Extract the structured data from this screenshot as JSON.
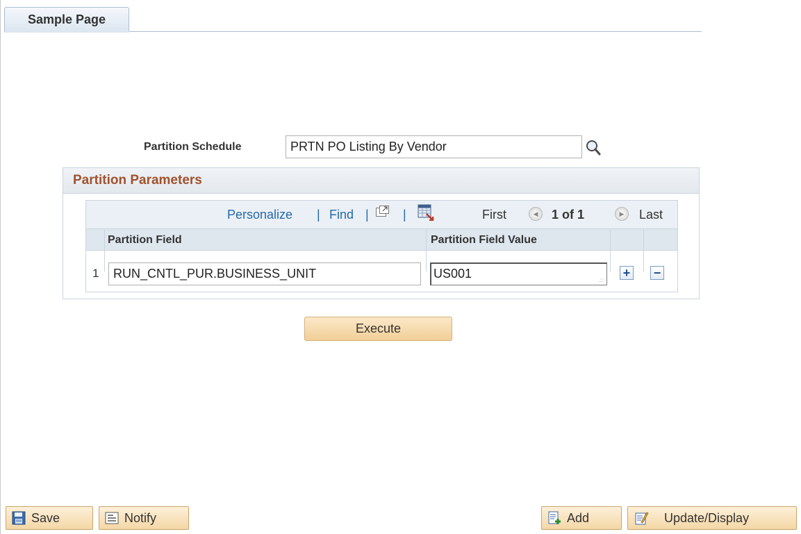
{
  "tab": {
    "label": "Sample Page"
  },
  "schedule": {
    "label": "Partition Schedule",
    "value": "PRTN PO Listing By Vendor"
  },
  "group": {
    "title": "Partition Parameters",
    "nav": {
      "personalize": "Personalize",
      "sep": "|",
      "find": "Find",
      "first": "First",
      "position": "1 of 1",
      "last": "Last"
    },
    "columns": [
      "Partition Field",
      "Partition Field Value"
    ],
    "rows": [
      {
        "num": "1",
        "field": "RUN_CNTL_PUR.BUSINESS_UNIT",
        "value": "US001"
      }
    ]
  },
  "execute": {
    "label": "Execute"
  },
  "toolbar": {
    "save": "Save",
    "notify": "Notify",
    "add": "Add",
    "update": "Update/Display"
  },
  "colors": {
    "accent": "#a0522d",
    "link": "#2569ad",
    "button": "#f1cf97"
  }
}
